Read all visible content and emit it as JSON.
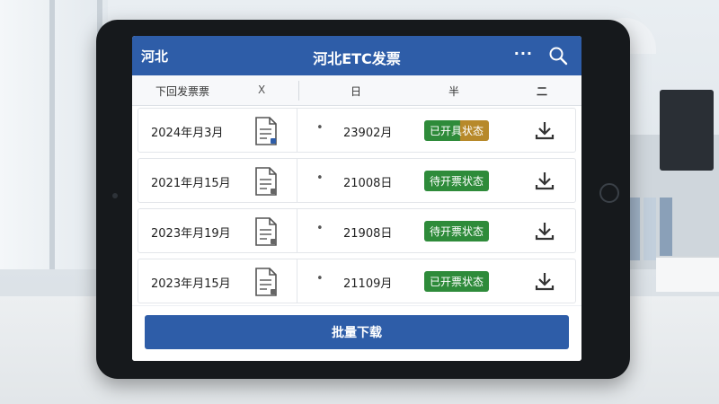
{
  "header": {
    "region": "河北",
    "title": "河北ETC发票",
    "more_label": "...",
    "search_icon": "search-icon"
  },
  "filters": {
    "invoice_type": "下回发票票",
    "clear": "X",
    "day": "日",
    "half": "半",
    "menu": "二"
  },
  "invoices": [
    {
      "date": "2024年月3月",
      "number": "23902月",
      "status": "已开具状态",
      "status_style": "mixed"
    },
    {
      "date": "2021年月15月",
      "number": "21008日",
      "status": "待开票状态",
      "status_style": "green"
    },
    {
      "date": "2023年月19月",
      "number": "21908日",
      "status": "待开票状态",
      "status_style": "green"
    },
    {
      "date": "2023年月15月",
      "number": "21109月",
      "status": "已开票状态",
      "status_style": "green"
    }
  ],
  "row_marker": "•",
  "batch_download": "批量下载",
  "colors": {
    "primary": "#2e5da8",
    "status_green": "#2e8b3a",
    "status_gold": "#b7892a"
  }
}
